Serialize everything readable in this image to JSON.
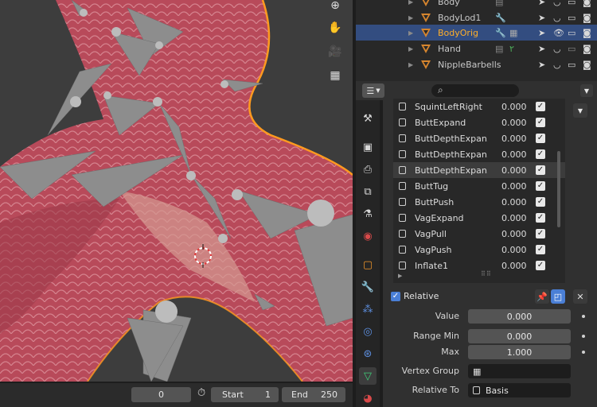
{
  "outliner": {
    "rows": [
      {
        "name": "Body"
      },
      {
        "name": "BodyLod1"
      },
      {
        "name": "BodyOrig"
      },
      {
        "name": "Hand"
      },
      {
        "name": "NippleBarbells"
      }
    ]
  },
  "shape_keys": {
    "rows": [
      {
        "name": "SquintLeftRight",
        "value": "0.000"
      },
      {
        "name": "ButtExpand",
        "value": "0.000"
      },
      {
        "name": "ButtDepthExpan...",
        "value": "0.000"
      },
      {
        "name": "ButtDepthExpan...",
        "value": "0.000"
      },
      {
        "name": "ButtDepthExpan...",
        "value": "0.000"
      },
      {
        "name": "ButtTug",
        "value": "0.000"
      },
      {
        "name": "ButtPush",
        "value": "0.000"
      },
      {
        "name": "VagExpand",
        "value": "0.000"
      },
      {
        "name": "VagPull",
        "value": "0.000"
      },
      {
        "name": "VagPush",
        "value": "0.000"
      },
      {
        "name": "Inflate1",
        "value": "0.000"
      }
    ]
  },
  "props": {
    "relative_label": "Relative",
    "value_label": "Value",
    "value": "0.000",
    "range_min_label": "Range Min",
    "range_min": "0.000",
    "max_label": "Max",
    "max": "1.000",
    "vertex_group_label": "Vertex Group",
    "relative_to_label": "Relative To",
    "relative_to": "Basis"
  },
  "timeline": {
    "current_frame": "0",
    "start_label": "Start",
    "start": "1",
    "end_label": "End",
    "end": "250"
  },
  "colors": {
    "selection": "#334d80",
    "active_object": "#ffaf29",
    "mesh_tone": "#b84a5a"
  }
}
